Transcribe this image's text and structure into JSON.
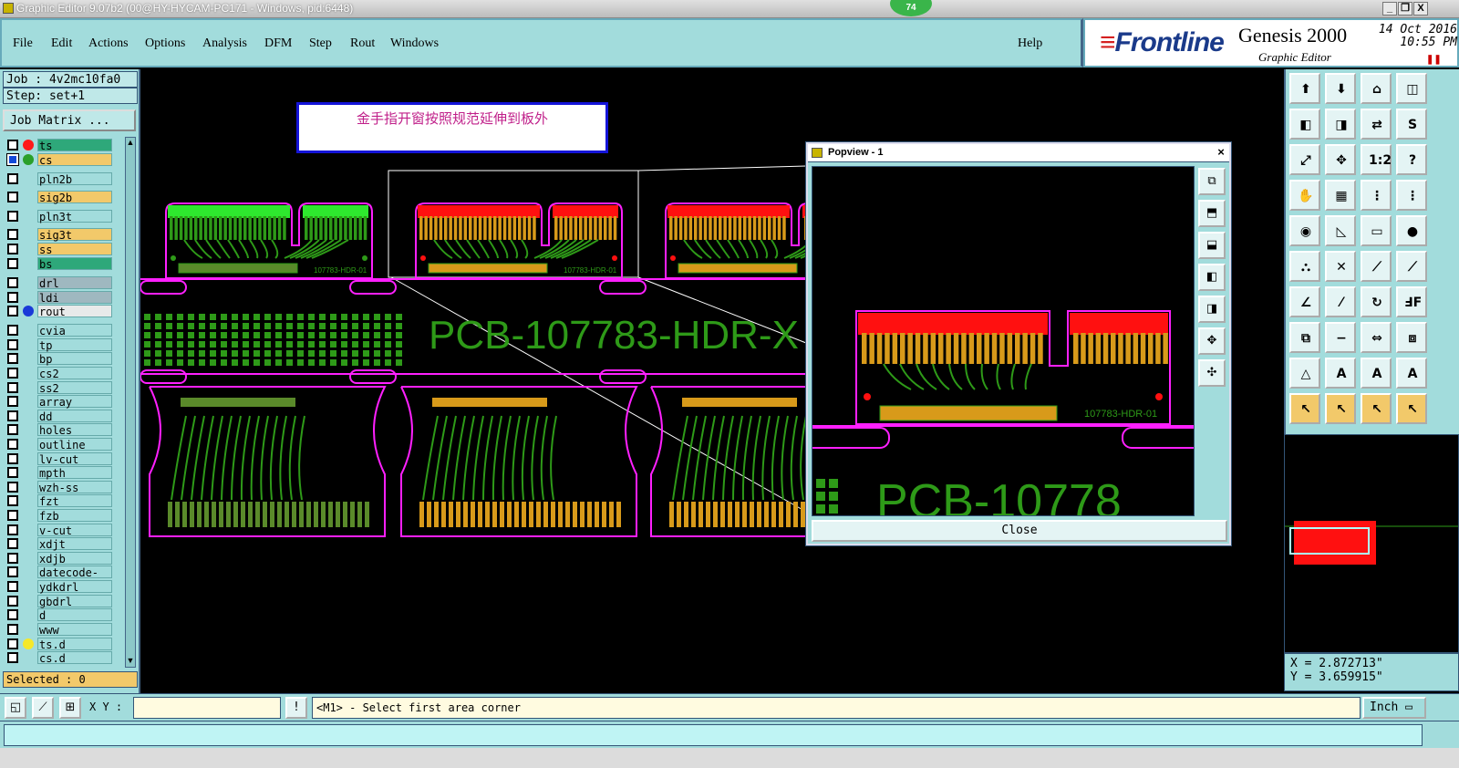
{
  "window": {
    "title": "Graphic Editor 9.07b2 (00@HY-HYCAM-PC171 - Windows, pid:6448)",
    "badge": "74",
    "minimize": "_",
    "restore": "❐",
    "close": "X"
  },
  "menu": {
    "items": [
      "File",
      "Edit",
      "Actions",
      "Options",
      "Analysis",
      "DFM",
      "Step",
      "Rout",
      "Windows"
    ],
    "help": "Help"
  },
  "brand": {
    "logo": "Frontline",
    "product": "Genesis 2000",
    "subtitle": "Graphic Editor",
    "date": "14 Oct 2016",
    "time": "10:55 PM"
  },
  "job": {
    "job_label": "Job : 4v2mc10fa0",
    "step_label": "Step: set+1",
    "job_matrix_button": "Job Matrix ..."
  },
  "layers": [
    {
      "name": "ts",
      "color": "#2ea87a",
      "dot": "#ff1a1a",
      "checked": false
    },
    {
      "name": "cs",
      "color": "#f2c96a",
      "dot": "#2aa02a",
      "checked": true
    },
    {
      "name": "pln2b",
      "color": "#a2dcdc",
      "dot": "",
      "checked": false
    },
    {
      "name": "sig2b",
      "color": "#f2c96a",
      "dot": "",
      "checked": false
    },
    {
      "name": "pln3t",
      "color": "#a2dcdc",
      "dot": "",
      "checked": false
    },
    {
      "name": "sig3t",
      "color": "#f2c96a",
      "dot": "",
      "checked": false
    },
    {
      "name": "ss",
      "color": "#f2c96a",
      "dot": "",
      "checked": false
    },
    {
      "name": "bs",
      "color": "#2ea87a",
      "dot": "",
      "checked": false
    },
    {
      "name": "drl",
      "color": "#9fb8c0",
      "dot": "",
      "checked": false
    },
    {
      "name": "ldi",
      "color": "#9fb8c0",
      "dot": "",
      "checked": false
    },
    {
      "name": "rout",
      "color": "#e8eaea",
      "dot": "#1a3ad8",
      "checked": false
    },
    {
      "name": "cvia",
      "color": "#a2dcdc",
      "dot": "",
      "checked": false
    },
    {
      "name": "tp",
      "color": "#a2dcdc",
      "dot": "",
      "checked": false
    },
    {
      "name": "bp",
      "color": "#a2dcdc",
      "dot": "",
      "checked": false
    },
    {
      "name": "cs2",
      "color": "#a2dcdc",
      "dot": "",
      "checked": false
    },
    {
      "name": "ss2",
      "color": "#a2dcdc",
      "dot": "",
      "checked": false
    },
    {
      "name": "array",
      "color": "#a2dcdc",
      "dot": "",
      "checked": false
    },
    {
      "name": "dd",
      "color": "#a2dcdc",
      "dot": "",
      "checked": false
    },
    {
      "name": "holes",
      "color": "#a2dcdc",
      "dot": "",
      "checked": false
    },
    {
      "name": "outline",
      "color": "#a2dcdc",
      "dot": "",
      "checked": false
    },
    {
      "name": "lv-cut",
      "color": "#a2dcdc",
      "dot": "",
      "checked": false
    },
    {
      "name": "mpth",
      "color": "#a2dcdc",
      "dot": "",
      "checked": false
    },
    {
      "name": "wzh-ss",
      "color": "#a2dcdc",
      "dot": "",
      "checked": false
    },
    {
      "name": "fzt",
      "color": "#a2dcdc",
      "dot": "",
      "checked": false
    },
    {
      "name": "fzb",
      "color": "#a2dcdc",
      "dot": "",
      "checked": false
    },
    {
      "name": "v-cut",
      "color": "#a2dcdc",
      "dot": "",
      "checked": false
    },
    {
      "name": "xdjt",
      "color": "#a2dcdc",
      "dot": "",
      "checked": false
    },
    {
      "name": "xdjb",
      "color": "#a2dcdc",
      "dot": "",
      "checked": false
    },
    {
      "name": "datecode-ss",
      "color": "#a2dcdc",
      "dot": "",
      "checked": false
    },
    {
      "name": "ydkdrl",
      "color": "#a2dcdc",
      "dot": "",
      "checked": false
    },
    {
      "name": "gbdrl",
      "color": "#a2dcdc",
      "dot": "",
      "checked": false
    },
    {
      "name": "d",
      "color": "#a2dcdc",
      "dot": "",
      "checked": false
    },
    {
      "name": "www",
      "color": "#a2dcdc",
      "dot": "",
      "checked": false
    },
    {
      "name": "ts.d",
      "color": "#a2dcdc",
      "dot": "#f5e82a",
      "checked": false
    },
    {
      "name": "cs.d",
      "color": "#a2dcdc",
      "dot": "",
      "checked": false
    }
  ],
  "selected": "Selected : 0",
  "canvas": {
    "note": "金手指开窗按照规范延伸到板外",
    "part_text": "PCB-107783-HDR-X",
    "board_label": "107783-HDR-01"
  },
  "popview": {
    "title": "Popview - 1",
    "close_button": "Close",
    "part_text": "PCB-10778",
    "board_label": "107783-HDR-01"
  },
  "coords": {
    "x": "X = 2.872713\"",
    "y": "Y = 3.659915\""
  },
  "bottom": {
    "xy_label": "X Y :",
    "xy_value": "",
    "status": "<M1> - Select first area corner",
    "units": "Inch"
  },
  "colors": {
    "panel": "#a2dcdc",
    "trace": "#2e9a18",
    "finger_red": "#ff1010",
    "finger_gold": "#d89a1a",
    "outline": "#ff20ff"
  }
}
